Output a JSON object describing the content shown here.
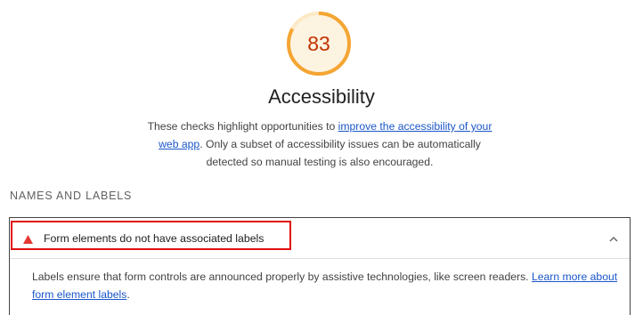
{
  "score": {
    "value": "83",
    "fraction": 0.83,
    "color": "#f4a532",
    "track_color": "#fde9c5",
    "text_color": "#c33300"
  },
  "category": {
    "title": "Accessibility",
    "description_prefix": "These checks highlight opportunities to ",
    "description_link": "improve the accessibility of your web app",
    "description_suffix": ". Only a subset of accessibility issues can be automatically detected so manual testing is also encouraged."
  },
  "group": {
    "title": "NAMES AND LABELS"
  },
  "audit": {
    "status_icon": "warning-triangle-icon",
    "status_color": "#e53935",
    "title": "Form elements do not have associated labels",
    "expanded": true,
    "toggle_icon": "chevron-up-icon",
    "body_text": "Labels ensure that form controls are announced properly by assistive technologies, like screen readers. ",
    "body_link": "Learn more about form element labels",
    "body_suffix": "."
  }
}
